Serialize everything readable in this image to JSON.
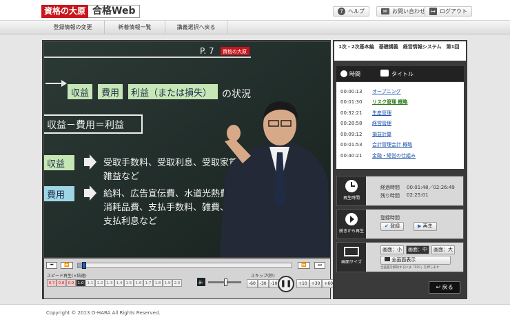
{
  "header": {
    "logo_red": "資格の大原",
    "logo_web": "合格Web",
    "help": "ヘルプ",
    "contact": "お問い合わせ",
    "logout": "ログアウト"
  },
  "menu": [
    "登録情報の変更",
    "新着情報一覧",
    "講義選択へ戻る"
  ],
  "slide": {
    "page": "P. 7",
    "brand": "資格の大原",
    "arrow_line_items": [
      "収益",
      "費用",
      "利益（または損失）"
    ],
    "arrow_line_suffix": "の状況",
    "formula": "収益－費用＝利益",
    "rev_label": "収益",
    "rev_text_1": "受取手数料、受取利息、受取家賃",
    "rev_text_2": "雑益など",
    "exp_label": "費用",
    "exp_text_1": "給料、広告宣伝費、水道光熱費、",
    "exp_text_2": "消耗品費、支払手数料、雑費、",
    "exp_text_3": "支払利息など"
  },
  "controls": {
    "speed_label": "スピード再生(×倍速)",
    "speeds": [
      "0.7",
      "0.8",
      "0.9",
      "1.0",
      "1.1",
      "1.2",
      "1.3",
      "1.4",
      "1.5",
      "1.6",
      "1.7",
      "1.8",
      "1.9",
      "2.0"
    ],
    "active_speed": "1.0",
    "skip_label": "スキップ(秒)",
    "skip_back": [
      "-60",
      "-30",
      "-10"
    ],
    "skip_fwd": [
      "+10",
      "+30",
      "+60"
    ],
    "progress_fraction": 0.03,
    "volume_fraction": 0.55
  },
  "right_panel": {
    "lecture_title": "1次・2次基本編　基礎講義　経営情報システム　第1回",
    "toc_header_time": "時間",
    "toc_header_title": "タイトル",
    "toc": [
      {
        "time": "00:00:13",
        "title": "オープニング",
        "active": false
      },
      {
        "time": "00:01:30",
        "title": "リスク管理 概略",
        "active": true
      },
      {
        "time": "00:32:21",
        "title": "生産管理",
        "active": false
      },
      {
        "time": "00:28:58",
        "title": "経営管理",
        "active": false
      },
      {
        "time": "00:09:12",
        "title": "損益計算",
        "active": false
      },
      {
        "time": "00:01:53",
        "title": "会計管理会計 概略",
        "active": false
      },
      {
        "time": "00:40:21",
        "title": "金融・経営の仕組み",
        "active": false
      }
    ],
    "play_time_label": "再生時間",
    "elapsed_label": "経過時間",
    "elapsed_value": "00:01:48／02:26:49",
    "remain_label": "残り時間",
    "remain_value": "02:25:01",
    "resume_label": "続きから再生",
    "register_time_label": "登録時間",
    "register_btn": "登録",
    "play_btn": "再生",
    "screen_size_label": "画面サイズ",
    "size_small": "画面：小",
    "size_mid": "画面：中",
    "size_large": "画面：大",
    "fullscreen_btn": "全画面表示",
    "fullscreen_note": "全画面を解除するには「ESC」を押します",
    "back_btn": "戻る"
  },
  "footer": {
    "copyright": "Copyright © 2013 O-HARA All Rights Reserved."
  }
}
